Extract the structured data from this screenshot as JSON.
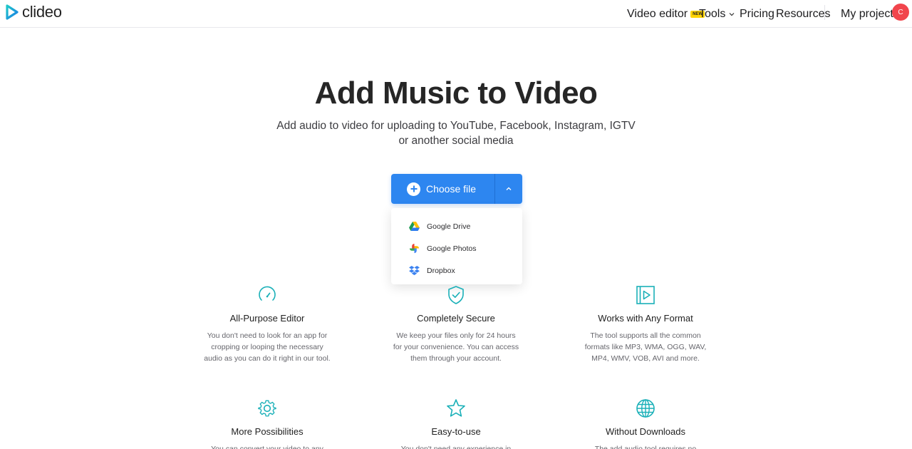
{
  "header": {
    "logo_text": "clideo",
    "nav": {
      "video_editor": "Video editor",
      "video_editor_badge": "NEW",
      "tools": "Tools",
      "pricing": "Pricing",
      "resources": "Resources",
      "my_projects": "My projects"
    },
    "avatar_initial": "C",
    "avatar_color": "#f1454c"
  },
  "hero": {
    "title": "Add Music to Video",
    "subtitle_line1": "Add audio to video for uploading to YouTube, Facebook, Instagram, IGTV",
    "subtitle_line2": "or another social media"
  },
  "upload": {
    "choose_file_label": "Choose file",
    "accent_color": "#2d86f0",
    "dropdown_open": true,
    "sources": [
      {
        "label": "Google Drive",
        "icon": "google-drive-icon"
      },
      {
        "label": "Google Photos",
        "icon": "google-photos-icon"
      },
      {
        "label": "Dropbox",
        "icon": "dropbox-icon"
      }
    ]
  },
  "features": [
    {
      "icon": "speedometer-icon",
      "title": "All-Purpose Editor",
      "desc": [
        "You don't need to look for an app for",
        "cropping or looping the necessary",
        "audio as you can do it right in our tool."
      ]
    },
    {
      "icon": "shield-check-icon",
      "title": "Completely Secure",
      "desc": [
        "We keep your files only for 24 hours",
        "for your convenience. You can access",
        "them through your account."
      ]
    },
    {
      "icon": "video-play-icon",
      "title": "Works with Any Format",
      "desc": [
        "The tool supports all the common",
        "formats like MP3, WMA, OGG, WAV,",
        "MP4, WMV, VOB, AVI and more."
      ]
    },
    {
      "icon": "gear-icon",
      "title": "More Possibilities",
      "desc": [
        "You can convert your video to any"
      ]
    },
    {
      "icon": "star-icon",
      "title": "Easy-to-use",
      "desc": [
        "You don't need any experience in"
      ]
    },
    {
      "icon": "globe-icon",
      "title": "Without Downloads",
      "desc": [
        "The add audio tool requires no"
      ]
    }
  ],
  "feature_icon_color": "#1ab0b8"
}
